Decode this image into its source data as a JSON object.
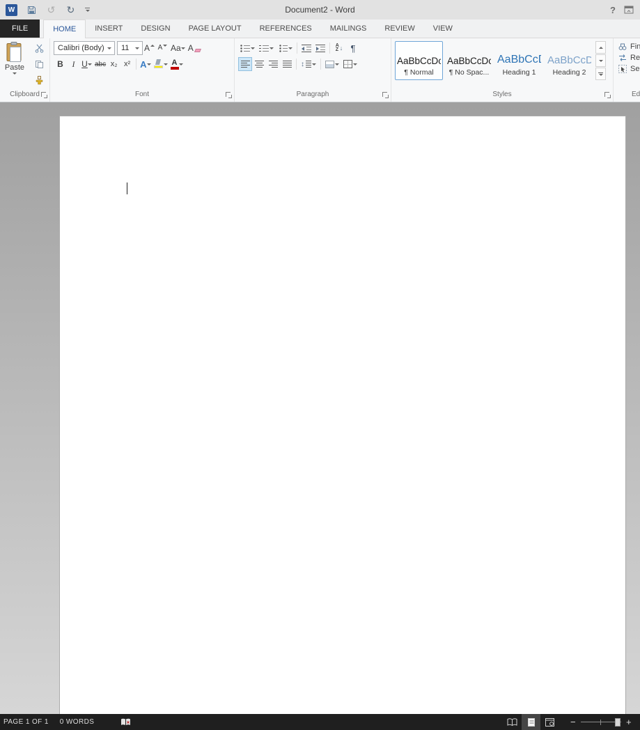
{
  "titlebar": {
    "title": "Document2 - Word",
    "word_logo_letter": "W",
    "help_glyph": "?"
  },
  "quick_access": {
    "undo_glyph": "↺",
    "redo_glyph": "↻"
  },
  "tabs": {
    "file": "FILE",
    "selected": "HOME",
    "items": [
      "HOME",
      "INSERT",
      "DESIGN",
      "PAGE LAYOUT",
      "REFERENCES",
      "MAILINGS",
      "REVIEW",
      "VIEW"
    ]
  },
  "ribbon": {
    "clipboard": {
      "group_label": "Clipboard",
      "paste_label": "Paste"
    },
    "font": {
      "group_label": "Font",
      "font_name_value": "Calibri (Body)",
      "font_size_value": "11",
      "grow_font": "A",
      "shrink_font": "A",
      "change_case": "Aa",
      "clear_formatting": "A",
      "bold": "B",
      "italic": "I",
      "underline": "U",
      "strikethrough": "abc",
      "subscript": "x₂",
      "superscript": "x²",
      "text_effects": "A",
      "font_color": "A"
    },
    "paragraph": {
      "group_label": "Paragraph",
      "sort_a": "A",
      "sort_z": "Z",
      "sort_arrow": "↓",
      "line_spacing_glyph": "↕",
      "pilcrow": "¶"
    },
    "styles": {
      "group_label": "Styles",
      "items": [
        {
          "preview": "AaBbCcDc",
          "name": "¶ Normal",
          "selected": true
        },
        {
          "preview": "AaBbCcDc",
          "name": "¶ No Spac...",
          "selected": false
        },
        {
          "preview": "AaBbCcD",
          "name": "Heading 1",
          "selected": false
        },
        {
          "preview": "AaBbCcD",
          "name": "Heading 2",
          "selected": false
        }
      ]
    },
    "editing": {
      "group_label": "Editing",
      "find_label": "Find",
      "replace_label": "Replace",
      "select_label": "Select"
    }
  },
  "statusbar": {
    "page_label": "PAGE 1 OF 1",
    "word_count": "0 WORDS",
    "zoom_out": "−",
    "zoom_in": "+"
  },
  "colors": {
    "accent_blue": "#2b579a",
    "heading1_blue": "#2e74b5",
    "heading2_blue": "#7da2c9",
    "highlight_yellow": "#fff200",
    "font_color_red": "#c00000",
    "dark_bar": "#1f1f1f"
  }
}
